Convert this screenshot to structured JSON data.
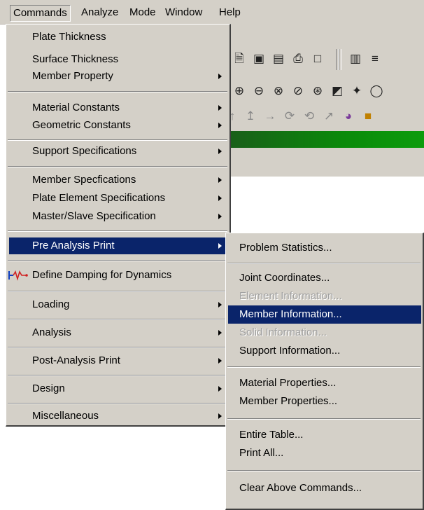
{
  "menubar": {
    "items": [
      "Commands",
      "Analyze",
      "Mode",
      "Window",
      "Help"
    ]
  },
  "commands_menu": {
    "items": [
      {
        "label": "Plate Thickness"
      },
      {
        "label": "Surface Thickness"
      },
      {
        "label": "Member Property"
      },
      {
        "label": "Material Constants"
      },
      {
        "label": "Geometric Constants"
      },
      {
        "label": "Support Specifications"
      },
      {
        "label": "Member Specfications"
      },
      {
        "label": "Plate Element Specifications"
      },
      {
        "label": "Master/Slave Specification"
      },
      {
        "label": "Pre Analysis Print"
      },
      {
        "label": "Define Damping for Dynamics",
        "icon": "damping-icon"
      },
      {
        "label": "Loading"
      },
      {
        "label": "Analysis"
      },
      {
        "label": "Post-Analysis Print"
      },
      {
        "label": "Design"
      },
      {
        "label": "Miscellaneous"
      }
    ]
  },
  "pre_analysis_submenu": {
    "items": [
      {
        "label": "Problem Statistics..."
      },
      {
        "label": "Joint Coordinates..."
      },
      {
        "label": "Element Information..."
      },
      {
        "label": "Member Information..."
      },
      {
        "label": "Solid Information..."
      },
      {
        "label": "Support Information..."
      },
      {
        "label": "Material Properties..."
      },
      {
        "label": "Member Properties..."
      },
      {
        "label": "Entire Table..."
      },
      {
        "label": "Print All..."
      },
      {
        "label": "Clear Above Commands..."
      }
    ]
  },
  "toolbar": {
    "icons": [
      "open-icon",
      "camera-icon",
      "export-icon",
      "print-icon",
      "print-preview-icon",
      "page-icon",
      "measure-icon",
      "zoom-in-icon",
      "zoom-out-icon",
      "zoom-window-icon",
      "zoom-dynamic-icon",
      "zoom-all-icon",
      "pan-icon",
      "magic-icon",
      "fy-icon",
      "fz-icon",
      "mx-icon",
      "my-icon",
      "mz-icon",
      "paint-icon",
      "color-icon"
    ]
  },
  "colors": {
    "menu_bg": "#d4d0c8",
    "highlight": "#0a246a",
    "disabled_text": "#a0a0a0",
    "green_bar": "#0a8a0a"
  }
}
